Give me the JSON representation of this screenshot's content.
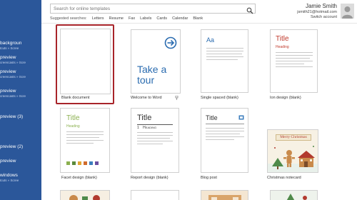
{
  "search": {
    "placeholder": "Search for online templates"
  },
  "suggested": {
    "label": "Suggested searches:",
    "items": [
      "Letters",
      "Resume",
      "Fax",
      "Labels",
      "Cards",
      "Calendar",
      "Blank"
    ]
  },
  "account": {
    "name": "Jamie Smith",
    "email": "jsmith21@hotmail.com",
    "switch_label": "Switch account"
  },
  "recent": [
    {
      "title": "backgroun",
      "sub": "tcuts » Scree"
    },
    {
      "title": "preview",
      "sub": "creencasts » Scre"
    },
    {
      "title": "preview",
      "sub": "creencasts » Scre"
    },
    {
      "title": "preview",
      "sub": "creencasts » Scre"
    },
    {
      "title": "preview (3)",
      "sub": ""
    },
    {
      "title": "preview (2)",
      "sub": ""
    },
    {
      "title": "preview",
      "sub": ""
    },
    {
      "title": "windows",
      "sub": "tcuts » Scree"
    }
  ],
  "templates": {
    "blank": {
      "caption": "Blank document"
    },
    "tour": {
      "caption": "Welcome to Word",
      "text": "Take a tour"
    },
    "single": {
      "caption": "Single spaced (blank)",
      "title": "Aa"
    },
    "ion": {
      "caption": "Ion design (blank)",
      "title": "Title",
      "heading": "Heading"
    },
    "facet": {
      "caption": "Facet design (blank)",
      "title": "Title",
      "heading": "Heading"
    },
    "report": {
      "caption": "Report design (blank)",
      "title": "Title",
      "heading": "Heading",
      "num": "1"
    },
    "blog": {
      "caption": "Blog post",
      "title": "Title"
    },
    "xmas": {
      "caption": "Christmas notecard",
      "banner": "Merry Christmas"
    }
  },
  "colors": {
    "left_pane": "#2b579a",
    "selected_border": "#a8242a",
    "accent_blue": "#2b6cb0",
    "ion_red": "#c0392b",
    "facet_green": "#8bb04f",
    "xmas_red": "#b23a2e"
  },
  "icons": {
    "search": "magnifier",
    "tour_arrow": "circle-arrow-right",
    "pin": "pushpin"
  }
}
